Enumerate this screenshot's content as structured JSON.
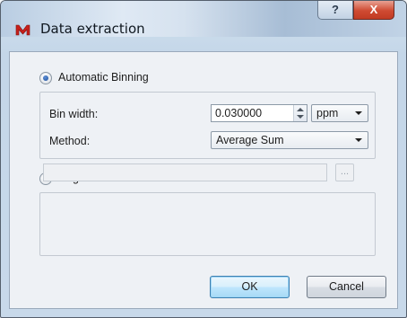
{
  "window": {
    "title": "Data extraction",
    "help_label": "?",
    "close_label": "X"
  },
  "binning": {
    "option_label": "Automatic Binning",
    "selected": true,
    "bin_width_label": "Bin width:",
    "bin_width_value": "0.030000",
    "unit_value": "ppm",
    "method_label": "Method:",
    "method_value": "Average Sum"
  },
  "regions": {
    "option_label": "Regions",
    "selected": false,
    "path_value": "",
    "browse_label": "..."
  },
  "buttons": {
    "ok_label": "OK",
    "cancel_label": "Cancel"
  },
  "colors": {
    "app_icon": "#c8201b",
    "close_button": "#c94530",
    "default_button_border": "#3c7fb1"
  }
}
